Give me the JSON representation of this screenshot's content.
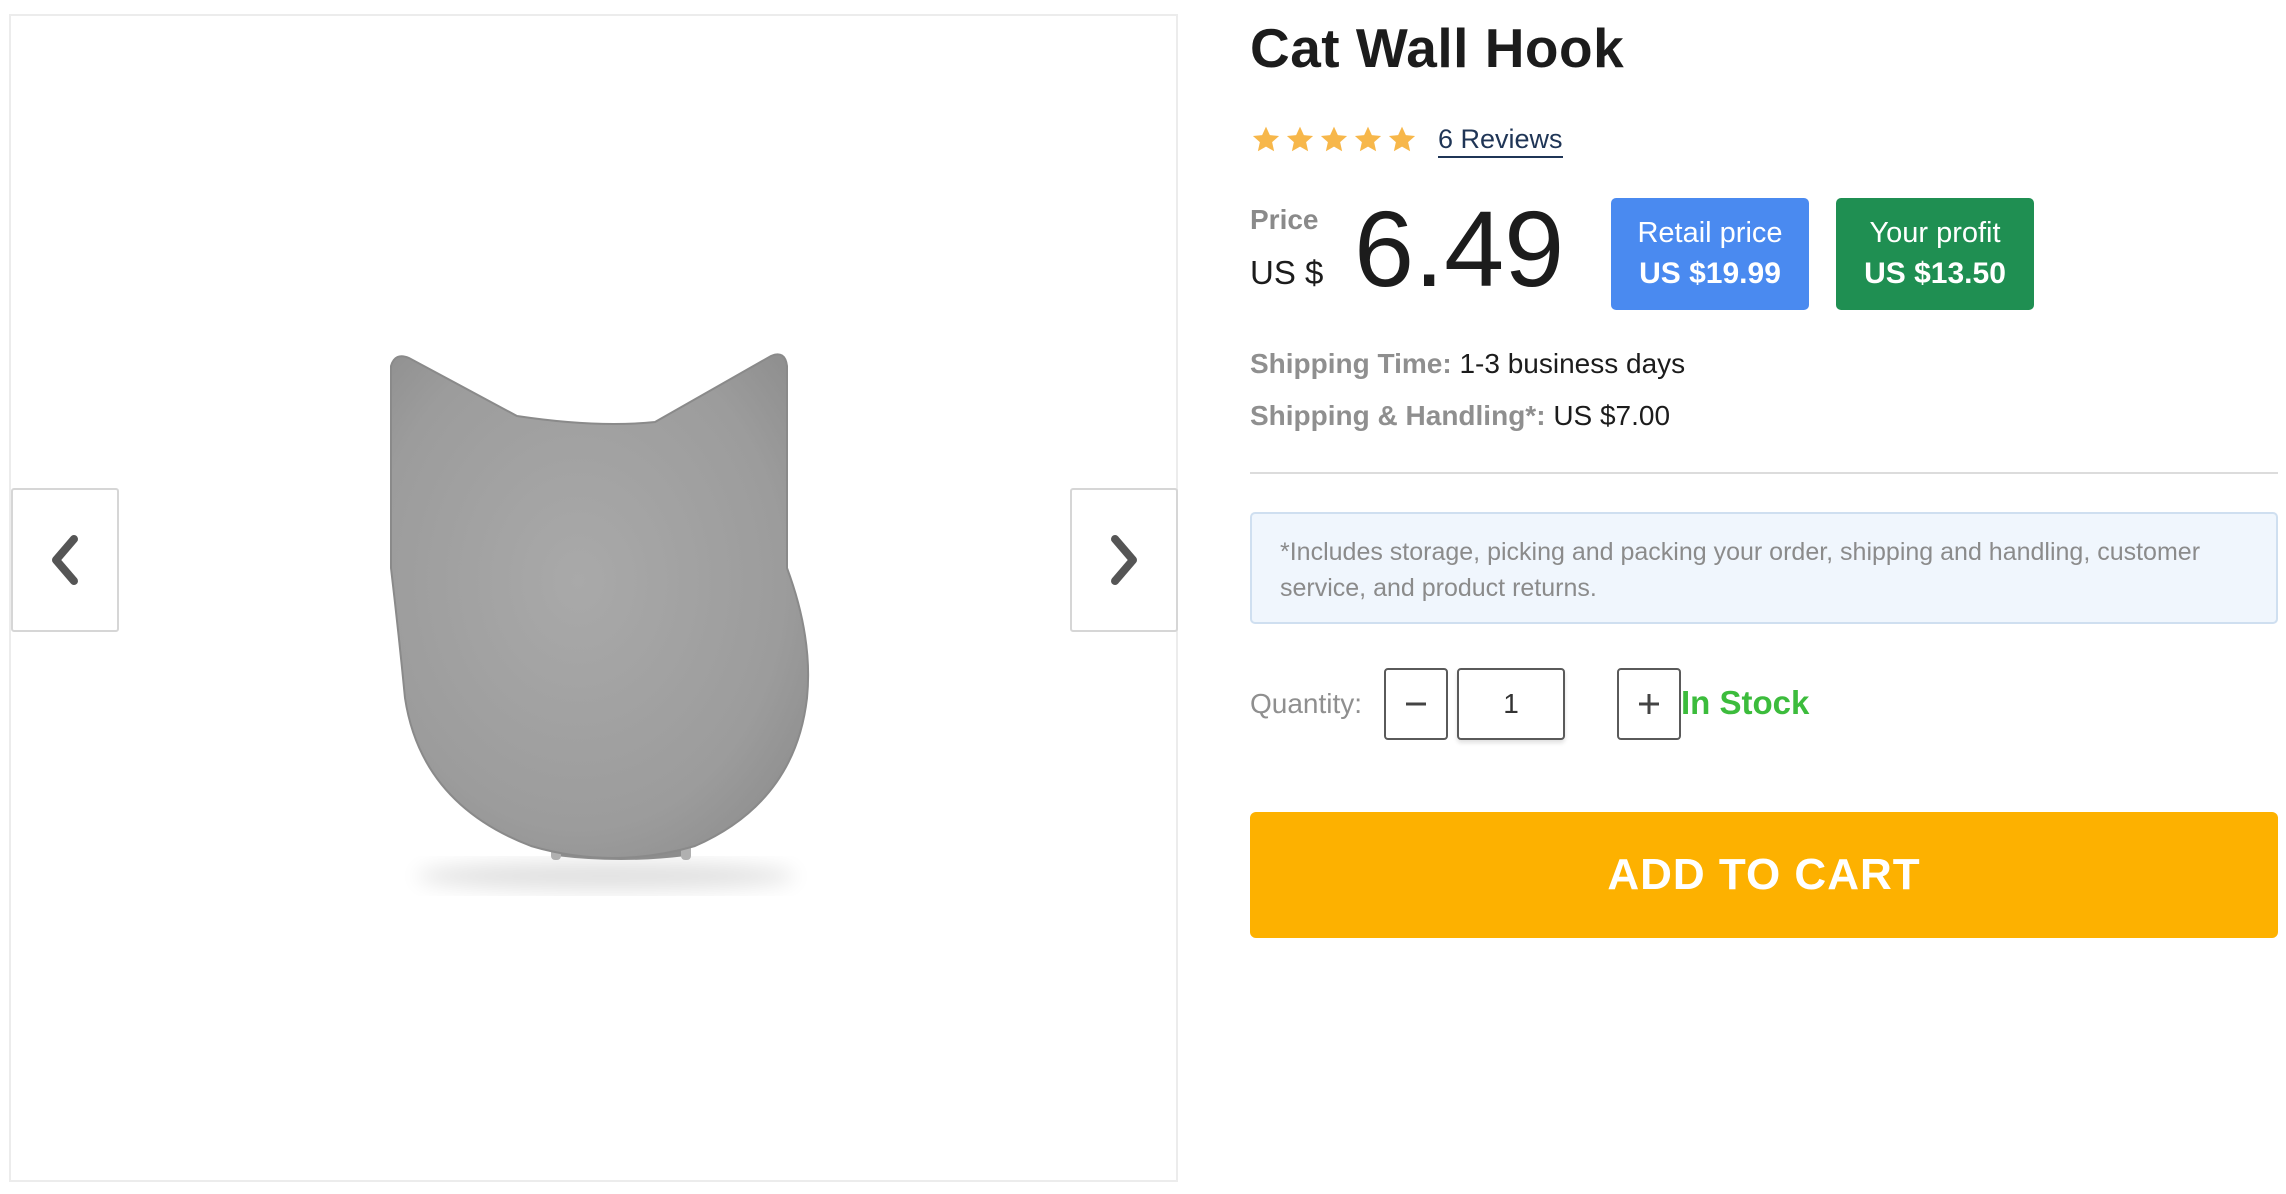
{
  "gallery": {
    "image_alt": "Cat Wall Hook",
    "prev_icon": "chevron-left-icon",
    "next_icon": "chevron-right-icon"
  },
  "product": {
    "title": "Cat Wall Hook",
    "rating": {
      "stars": 5,
      "reviews_label": "6 Reviews",
      "star_color": "#f7b74a"
    },
    "price": {
      "label": "Price",
      "currency": "US $",
      "value": "6.49"
    },
    "retail": {
      "label": "Retail price",
      "value": "US $19.99",
      "color": "#4a8af0"
    },
    "profit": {
      "label": "Your profit",
      "value": "US $13.50",
      "color": "#1f8f52"
    },
    "shipping": {
      "time_label": "Shipping Time:",
      "time_value": "1-3 business days",
      "handling_label": "Shipping & Handling*:",
      "handling_value": "US $7.00"
    },
    "note": "*Includes storage, picking and packing your order, shipping and handling, customer service, and product returns.",
    "quantity": {
      "label": "Quantity:",
      "value": "1",
      "minus_icon": "minus-icon",
      "plus_icon": "plus-icon"
    },
    "stock_status": "In Stock",
    "stock_color": "#3cbc3c",
    "cta_label": "ADD TO CART",
    "cta_color": "#fdb100"
  }
}
